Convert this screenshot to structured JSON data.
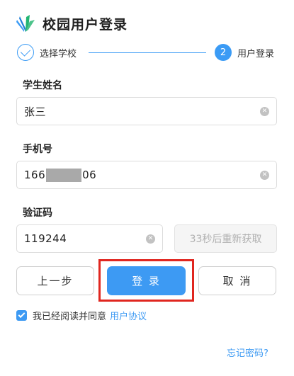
{
  "header": {
    "title": "校园用户登录",
    "logo_icon": "book-logo-icon"
  },
  "steps": [
    {
      "label": "选择学校",
      "state": "done"
    },
    {
      "number": "2",
      "label": "用户登录",
      "state": "active"
    }
  ],
  "form": {
    "name": {
      "label": "学生姓名",
      "value": "张三"
    },
    "phone": {
      "label": "手机号",
      "value_prefix": "166",
      "value_suffix": "06"
    },
    "code": {
      "label": "验证码",
      "value": "119244",
      "resend_label": "33秒后重新获取"
    }
  },
  "buttons": {
    "prev": "上一步",
    "login": "登 录",
    "cancel": "取 消"
  },
  "agreement": {
    "checked": true,
    "text": "我已经阅读并同意",
    "link": "用户协议"
  },
  "forgot": "忘记密码?",
  "colors": {
    "accent": "#3d9af3",
    "highlight": "#e0261f"
  }
}
